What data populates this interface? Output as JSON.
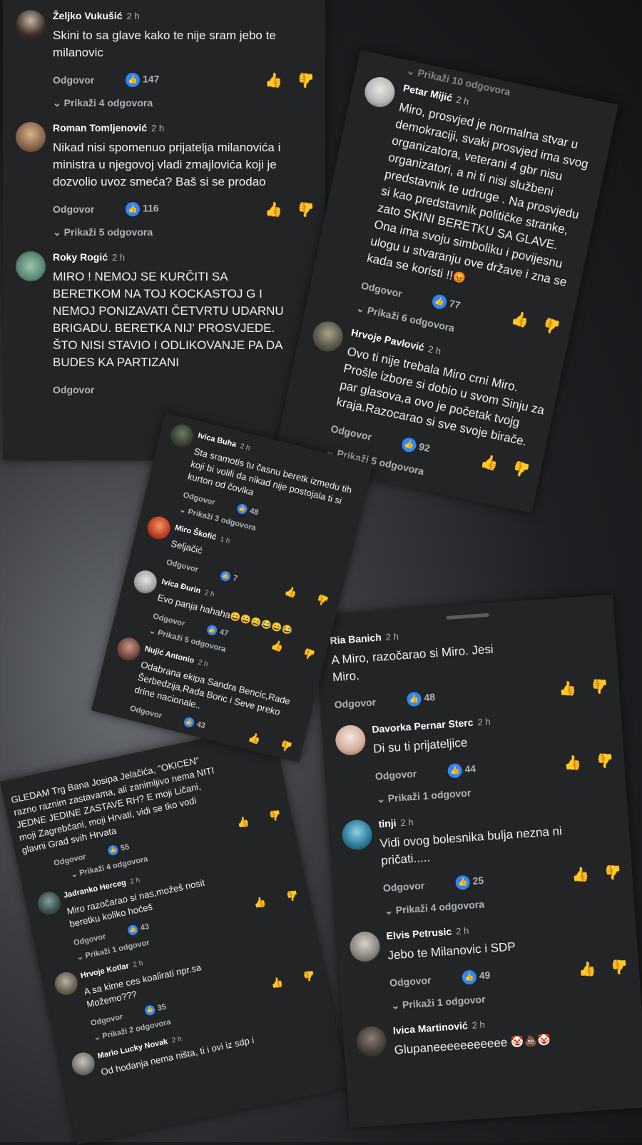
{
  "cards": [
    {
      "comments": [
        {
          "name": "Željko Vukušić",
          "time": "2 h",
          "text": "Skini to sa glave kako te nije sram jebo te milanovic",
          "reply": "Odgovor",
          "likes": "147",
          "more": "Prikaži 4 odgovora"
        },
        {
          "name": "Roman Tomljenović",
          "time": "2 h",
          "text": "Nikad nisi spomenuo prijatelja milanovića i ministra u njegovoj vladi zmajlovića koji je dozvolio uvoz smeća? Baš si se prodao",
          "reply": "Odgovor",
          "likes": "116",
          "more": "Prikaži 5 odgovora"
        },
        {
          "name": "Roky Rogić",
          "time": "2 h",
          "text": "MIRO ! NEMOJ SE KURČITI SA BERETKOM  NA TOJ KOCKASTOJ G I NEMOJ PONIZAVATI ČETVRTU UDARNU BRIGADU. BERETKA NIJ' PROSVJEDE. ŠTO NISI STAVIO I ODLIKOVANJE PA DA BUDES KA PARTIZANI",
          "reply": "Odgovor"
        }
      ]
    },
    {
      "top_fragment": "Prikaži 10 odgovora",
      "comments": [
        {
          "name": "Petar Mijić",
          "time": "2 h",
          "text": "Miro, prosvjed je normalna stvar u demokraciji, svaki prosvjed ima svog organizatora, veterani  4 gbr nisu organizatori, a ni ti nisi službeni predstavnik te udruge . Na prosvjedu si kao predstavnik političke stranke, zato SKINI BERETKU SA GLAVE. Ona ima svoju simboliku i  povijesnu ulogu u stvaranju ove države i zna se kada se koristi !!",
          "emoji": "😡",
          "reply": "Odgovor",
          "likes": "77",
          "more": "Prikaži 6 odgovora"
        },
        {
          "name": "Hrvoje Pavlović",
          "time": "2 h",
          "text": "Ovo ti nije trebala Miro crni Miro. Prošle izbore si dobio u svom Sinju za par glasova,a ovo je početak tvojg kraja.Razocarao si sve svoje birače.",
          "reply": "Odgovor",
          "likes": "92",
          "more": "Prikaži 5 odgovora"
        }
      ]
    },
    {
      "comments": [
        {
          "name": "Ivica Buha",
          "time": "2 h",
          "text": "Sta sramotis tu časnu beretk izmedu tih koji bi volili da nikad nije postojala ti si kurton od čovika",
          "reply": "Odgovor",
          "likes": "48",
          "more": "Prikaži 3 odgovora"
        },
        {
          "name": "Miro Škofić",
          "time": "1 h",
          "text": "Seljačić",
          "reply": "Odgovor",
          "likes": "7"
        },
        {
          "name": "Ivica Đurin",
          "time": "2 h",
          "text": "Evo panja hahaha",
          "emoji": "😄😄😄😂😄😂",
          "reply": "Odgovor",
          "likes": "47",
          "more": "Prikaži 5 odgovora"
        },
        {
          "name": "Nujić Antonio",
          "time": "2 h",
          "text": "Odabrana ekipa Sandra Bencic,Rade Šerbedzija,Rada Boric i Seve preko drine nacionale..",
          "reply": "Odgovor",
          "likes": "43"
        }
      ]
    },
    {
      "comments": [
        {
          "name": "Ria Banich",
          "time": "2 h",
          "text": "A Miro, razočarao si Miro. Jesi Miro.",
          "reply": "Odgovor",
          "likes": "48"
        },
        {
          "name": "Davorka Pernar Sterc",
          "time": "2 h",
          "text": "Di su ti prijateljice",
          "reply": "Odgovor",
          "likes": "44",
          "more": "Prikaži 1 odgovor"
        },
        {
          "name": "tinji",
          "time": "2 h",
          "text": "Vidi ovog bolesnika bulja nezna ni pričati.....",
          "reply": "Odgovor",
          "likes": "25",
          "more": "Prikaži 4 odgovora"
        },
        {
          "name": "Elvis Petrusic",
          "time": "2 h",
          "text": "Jebo te Milanovic i SDP",
          "reply": "Odgovor",
          "likes": "49",
          "more": "Prikaži 1 odgovor"
        },
        {
          "name": "Ivica Martinović",
          "time": "2 h",
          "text": "Glupaneeeeeeeeeee",
          "emoji": "🤡💩🤡"
        }
      ]
    },
    {
      "comments": [
        {
          "name": "",
          "time": "",
          "text": "GLEDAM Trg Bana Josipa Jelačića, \"OKICEN\" razno raznim zastavama, ali zanimljivo nema NITI JEDNE JEDINE ZASTAVE RH? E moji Ličani, moji Zagrebčani, moji Hrvati, vidi se tko vodi glavni Grad svih Hrvata",
          "reply": "Odgovor",
          "likes": "55",
          "more": "Prikaži 4 odgovora"
        },
        {
          "name": "Jadranko Herceg",
          "time": "2 h",
          "text": "Miro razočarao si nas,možeš nosit beretku koliko hoćeš",
          "reply": "Odgovor",
          "likes": "43",
          "more": "Prikaži 1 odgovor"
        },
        {
          "name": "Hrvoje Kotlar",
          "time": "2 h",
          "text": "A sa kime ces koalirati npr.sa Možemo???",
          "reply": "Odgovor",
          "likes": "35",
          "more": "Prikaži 2 odgovora"
        },
        {
          "name": "Mario Lucky Novak",
          "time": "2 h",
          "text": "Od hodanja nema ništa, ti i ovi iz sdp i"
        }
      ]
    }
  ]
}
